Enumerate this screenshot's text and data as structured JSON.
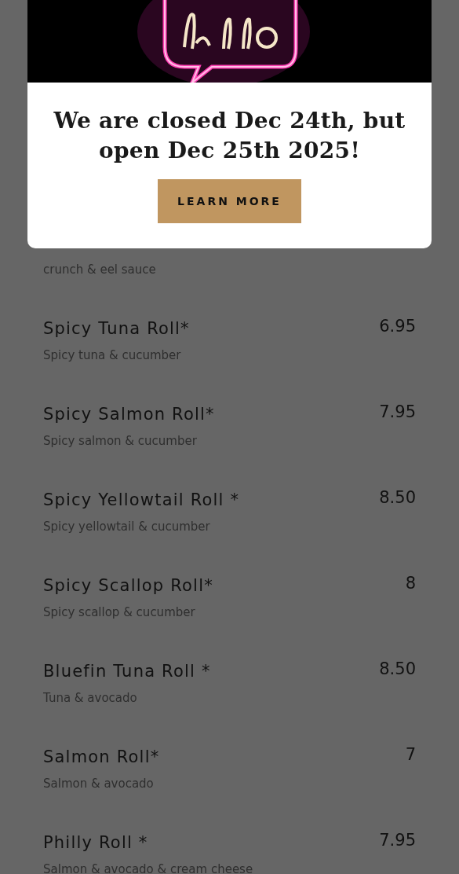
{
  "modal": {
    "title": "We are closed Dec 24th, but open Dec 25th 2025!",
    "button": "LEARN MORE"
  },
  "menu": {
    "partial_description": "crunch & eel sauce",
    "items": [
      {
        "name": "Spicy Tuna Roll*",
        "price": "6.95",
        "description": "Spicy tuna & cucumber"
      },
      {
        "name": "Spicy Salmon Roll*",
        "price": "7.95",
        "description": "Spicy salmon & cucumber"
      },
      {
        "name": "Spicy Yellowtail Roll *",
        "price": "8.50",
        "description": "Spicy yellowtail & cucumber"
      },
      {
        "name": "Spicy Scallop Roll*",
        "price": "8",
        "description": "Spicy scallop & cucumber"
      },
      {
        "name": "Bluefin Tuna Roll *",
        "price": "8.50",
        "description": "Tuna & avocado"
      },
      {
        "name": "Salmon Roll*",
        "price": "7",
        "description": "Salmon & avocado"
      },
      {
        "name": "Philly Roll *",
        "price": "7.95",
        "description": "Salmon & avocado & cream cheese"
      }
    ]
  }
}
